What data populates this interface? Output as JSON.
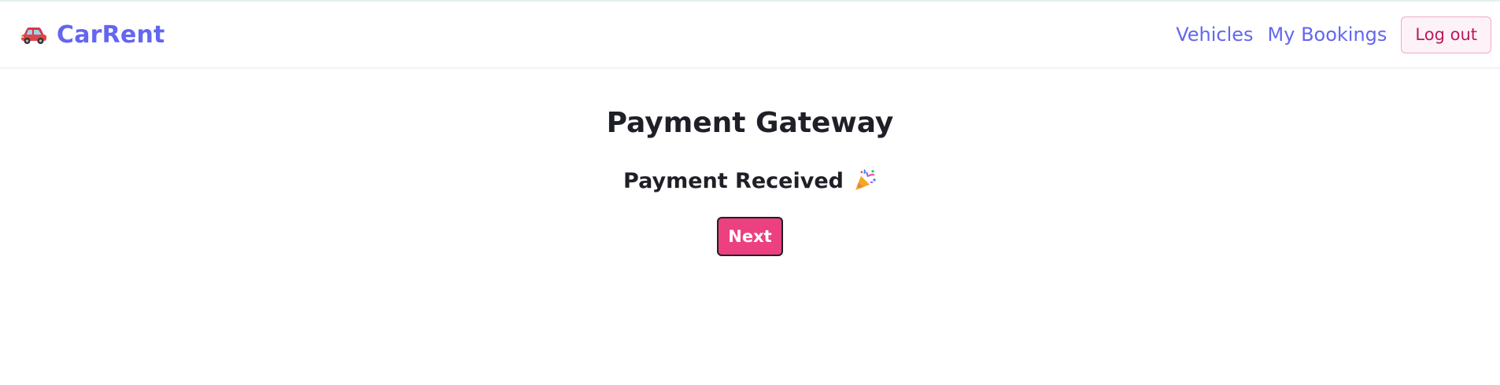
{
  "navbar": {
    "brand_icon": "red-car-icon",
    "brand_name": "CarRent",
    "links": [
      {
        "label": "Vehicles"
      },
      {
        "label": "My Bookings"
      }
    ],
    "logout_label": "Log out"
  },
  "main": {
    "title": "Payment Gateway",
    "status_text": "Payment Received",
    "status_icon": "party-popper-icon",
    "next_label": "Next"
  },
  "colors": {
    "brand": "#6366f1",
    "accent": "#ec4080",
    "logout_text": "#be185d",
    "heading": "#1f1f27"
  }
}
